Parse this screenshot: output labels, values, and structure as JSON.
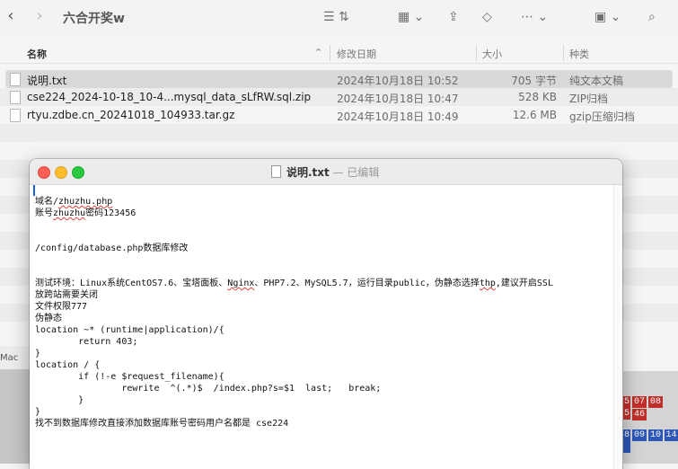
{
  "finder": {
    "title": "六合开奖w",
    "toolbar_icons": [
      "back-icon",
      "forward-icon",
      "list-view-icon",
      "grid-view-icon",
      "share-icon",
      "tag-icon",
      "more-icon",
      "storage-icon",
      "search-icon"
    ],
    "columns": {
      "name": "名称",
      "date": "修改日期",
      "size": "大小",
      "kind": "种类"
    },
    "files": [
      {
        "name": "说明.txt",
        "date": "2024年10月18日 10:52",
        "size": "705 字节",
        "kind": "纯文本文稿"
      },
      {
        "name": "cse224_2024-10-18_10-4...mysql_data_sLfRW.sql.zip",
        "date": "2024年10月18日 10:47",
        "size": "528 KB",
        "kind": "ZIP归档"
      },
      {
        "name": "rtyu.zdbe.cn_20241018_104933.tar.gz",
        "date": "2024年10月18日 10:49",
        "size": "12.6 MB",
        "kind": "gzip压缩归档"
      }
    ]
  },
  "background": {
    "left_label": "Mac",
    "calendar": [
      "5",
      "07",
      "08",
      "5",
      "46",
      "",
      "8",
      "09",
      "10",
      "14"
    ]
  },
  "editor": {
    "filename": "说明.txt",
    "status": " — 已编辑",
    "lines": {
      "l1a": "域名/",
      "l1b": "zhuzhu.php",
      "l2a": "账号",
      "l2b": "zhuzhu",
      "l2c": "密码123456",
      "l3": "/config/database.php数据库修改",
      "l4a": "测试环境：Linux系统CentOS7.6、宝塔面板、",
      "l4b": "Nginx",
      "l4c": "、PHP7.2、MySQL5.7，运行目录public，伪静态选择",
      "l4d": "thp",
      "l4e": ",建议开启SSL",
      "l5": "放跨站需要关闭",
      "l6": "文件权限777",
      "l7": "伪静态",
      "l8": "location ~* (runtime|application)/{",
      "l9": "        return 403;",
      "l10": "}",
      "l11": "location / {",
      "l12": "        if (!-e $request_filename){",
      "l13": "                rewrite  ^(.*)$  /index.php?s=$1  last;   break;",
      "l14": "        }",
      "l15": "}",
      "l16": "找不到数据库修改直接添加数据库账号密码用户名都是 cse224"
    }
  }
}
